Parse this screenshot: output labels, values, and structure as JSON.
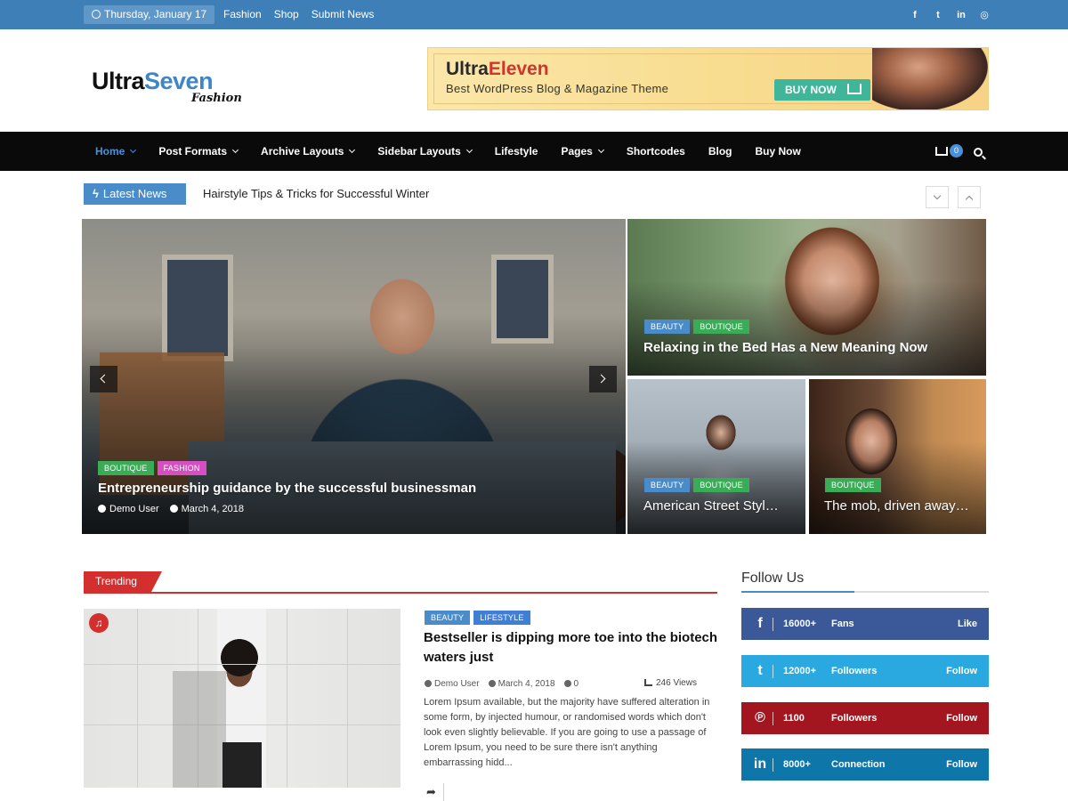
{
  "topbar": {
    "date": "Thursday, January 17",
    "links": [
      "Fashion",
      "Shop",
      "Submit News"
    ],
    "social_icons": [
      "facebook-icon",
      "twitter-icon",
      "linkedin-icon",
      "instagram-icon"
    ],
    "background": "#3f7fb8"
  },
  "header": {
    "logo_part1": "Ultra",
    "logo_part2": "Seven",
    "logo_tagline": "Fashion",
    "ad": {
      "title_part1": "Ultra",
      "title_part2": "Eleven",
      "subtitle": "Best WordPress Blog & Magazine Theme",
      "button": "BUY NOW"
    }
  },
  "nav": {
    "items": [
      {
        "label": "Home",
        "active": true,
        "dropdown": true
      },
      {
        "label": "Post Formats",
        "dropdown": true
      },
      {
        "label": "Archive Layouts",
        "dropdown": true
      },
      {
        "label": "Sidebar Layouts",
        "dropdown": true
      },
      {
        "label": "Lifestyle",
        "dropdown": false
      },
      {
        "label": "Pages",
        "dropdown": true
      },
      {
        "label": "Shortcodes",
        "dropdown": false
      },
      {
        "label": "Blog",
        "dropdown": false
      },
      {
        "label": "Buy Now",
        "dropdown": false
      }
    ],
    "cart_count": "0",
    "accent": "#4a90d9"
  },
  "ticker": {
    "label": "Latest News",
    "headline": "Hairstyle Tips & Tricks for Successful Winter"
  },
  "hero": {
    "main": {
      "tags": [
        "BOUTIQUE",
        "FASHION"
      ],
      "title": "Entrepreneurship guidance by the successful businessman",
      "author": "Demo User",
      "date": "March 4, 2018"
    },
    "right_top": {
      "tags": [
        "BEAUTY",
        "BOUTIQUE"
      ],
      "title": "Relaxing in the Bed Has a New Meaning Now"
    },
    "small_1": {
      "tags": [
        "BEAUTY",
        "BOUTIQUE"
      ],
      "title": "American Street Styl…"
    },
    "small_2": {
      "tags": [
        "BOUTIQUE"
      ],
      "title": "The mob, driven away…"
    }
  },
  "trending": {
    "label": "Trending",
    "post": {
      "tags": [
        "BEAUTY",
        "LIFESTYLE"
      ],
      "title": "Bestseller is dipping more toe into the biotech waters just",
      "author": "Demo User",
      "date": "March 4, 2018",
      "comments": "0",
      "views": "246 Views",
      "excerpt": "Lorem Ipsum available, but the majority have suffered alteration in some form, by injected humour, or randomised words which don't look even slightly believable. If you are going to use a passage of Lorem Ipsum, you need to be sure there isn't anything embarrassing hidd..."
    }
  },
  "follow": {
    "title": "Follow Us",
    "networks": [
      {
        "icon": "facebook-icon",
        "count": "16000+",
        "label": "Fans",
        "action": "Like",
        "color": "#3b5998"
      },
      {
        "icon": "twitter-icon",
        "count": "12000+",
        "label": "Followers",
        "action": "Follow",
        "color": "#2aa9e0"
      },
      {
        "icon": "pinterest-icon",
        "count": "1100",
        "label": "Followers",
        "action": "Follow",
        "color": "#a4161f"
      },
      {
        "icon": "linkedin-icon",
        "count": "8000+",
        "label": "Connection",
        "action": "Follow",
        "color": "#0e76a8"
      }
    ]
  }
}
